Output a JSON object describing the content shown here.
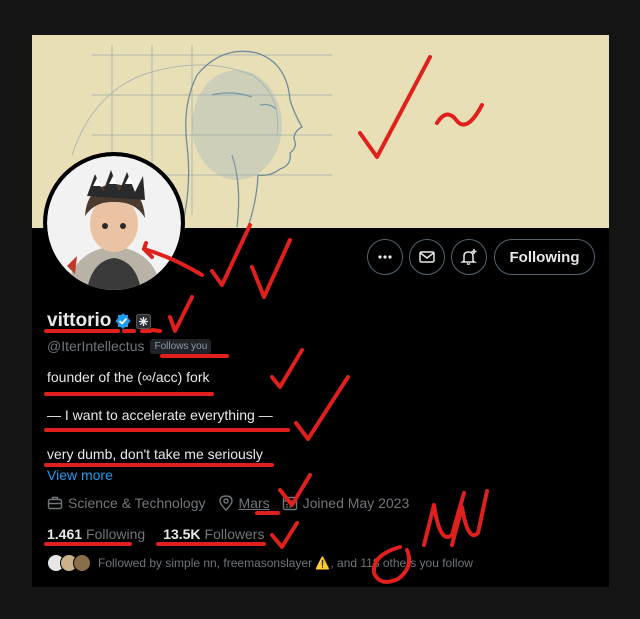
{
  "profile": {
    "display_name": "vittorio",
    "handle": "@IterIntellectus",
    "follows_you_badge": "Follows you",
    "bio": [
      "founder of the (∞/acc) fork",
      "— I want to accelerate everything —",
      "very dumb, don't take me seriously"
    ],
    "view_more": "View more",
    "category": "Science & Technology",
    "location": "Mars",
    "joined": "Joined May 2023",
    "following_count": "1.461",
    "following_label": "Following",
    "followers_count": "13.5K",
    "followers_label": "Followers",
    "followed_by_text": "Followed by simple nn, freemasonslayer ⚠️, and 118 others you follow"
  },
  "actions": {
    "more_icon": "more-icon",
    "message_icon": "mail-icon",
    "notify_icon": "bell-plus-icon",
    "following_button": "Following"
  },
  "colors": {
    "background": "#000000",
    "text": "#e7e9ea",
    "muted": "#71767b",
    "link": "#1d9bf0",
    "verified": "#1d9bf0",
    "annotation": "#e0201c",
    "banner": "#e9dfb6"
  }
}
